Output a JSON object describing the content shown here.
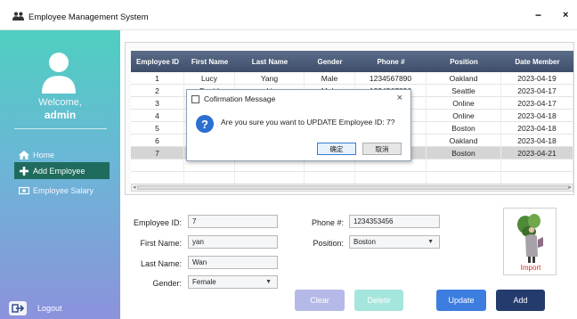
{
  "window": {
    "title": "Employee Management System",
    "minimize": "−",
    "close": "×"
  },
  "sidebar": {
    "welcome": "Welcome,",
    "user": "admin",
    "items": [
      {
        "label": "Home",
        "icon": "home-icon"
      },
      {
        "label": "Add Employee",
        "icon": "plus-icon",
        "active": true
      },
      {
        "label": "Employee Salary",
        "icon": "money-icon"
      }
    ],
    "logout": "Logout"
  },
  "table": {
    "headers": [
      "Employee ID",
      "First Name",
      "Last Name",
      "Gender",
      "Phone #",
      "Position",
      "Date Member"
    ],
    "rows": [
      [
        "1",
        "Lucy",
        "Yang",
        "Male",
        "1234567890",
        "Oakland",
        "2023-04-19"
      ],
      [
        "2",
        "David",
        "Li",
        "Male",
        "1234567896",
        "Seattle",
        "2023-04-17"
      ],
      [
        "3",
        "",
        "",
        "",
        "",
        "Online",
        "2023-04-17"
      ],
      [
        "4",
        "",
        "",
        "",
        "",
        "Online",
        "2023-04-18"
      ],
      [
        "5",
        "",
        "",
        "",
        "",
        "Boston",
        "2023-04-18"
      ],
      [
        "6",
        "",
        "",
        "",
        "",
        "Oakland",
        "2023-04-18"
      ],
      [
        "7",
        "",
        "",
        "",
        "",
        "Boston",
        "2023-04-21"
      ]
    ],
    "selected_row": 6
  },
  "dialog": {
    "title": "Cofirmation Message",
    "message": "Are you sure you want to UPDATE Employee ID: 7?",
    "ok": "确定",
    "cancel": "取消"
  },
  "form": {
    "employee_id_label": "Employee ID:",
    "employee_id_value": "7",
    "first_name_label": "First Name:",
    "first_name_value": "yan",
    "last_name_label": "Last Name:",
    "last_name_value": "Wan",
    "gender_label": "Gender:",
    "gender_value": "Female",
    "phone_label": "Phone #:",
    "phone_value": "1234353456",
    "position_label": "Position:",
    "position_value": "Boston",
    "import_label": "Import"
  },
  "buttons": {
    "clear": "Clear",
    "delete": "Delete",
    "update": "Update",
    "add": "Add"
  },
  "colors": {
    "table_header": "#4a5a78",
    "active_nav": "#1f6b5d",
    "clear_btn": "#b5b9e8",
    "delete_btn": "#a5e6dc",
    "update_btn": "#3d7de0",
    "add_btn": "#243b6d"
  }
}
